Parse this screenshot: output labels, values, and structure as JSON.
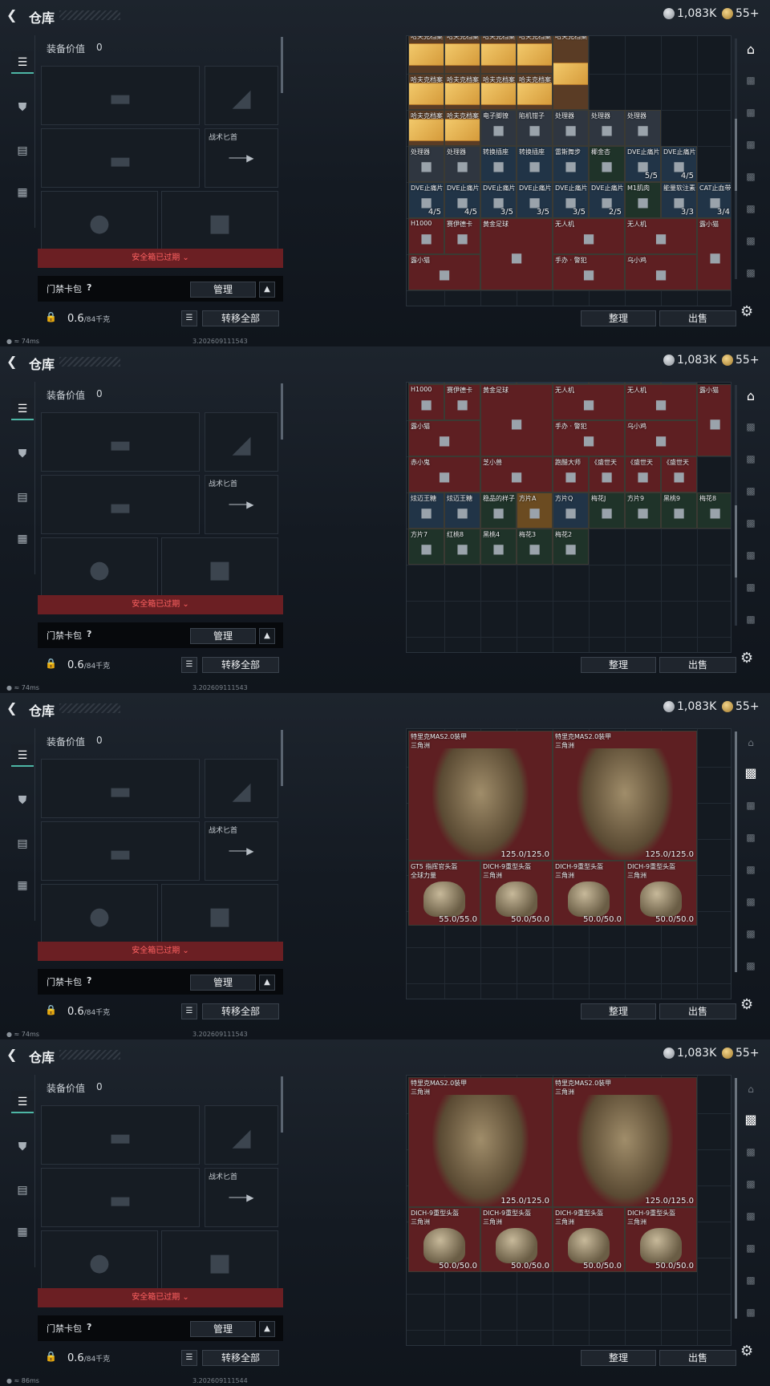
{
  "header": {
    "title": "仓库",
    "silver": "1,083K",
    "gold": "55+"
  },
  "left": {
    "equip_label": "装备价值",
    "equip_value": "0",
    "knife_label": "战术匕首",
    "expired": "安全箱已过期",
    "key_label": "门禁卡包",
    "key_help": "?",
    "manage": "管理",
    "weight": "0.6",
    "weight_cap": "/84千克",
    "move_all": "转移全部"
  },
  "actions": {
    "arrange": "整理",
    "sell": "出售"
  },
  "build": "3.202609111543",
  "build4": "3.202609111544",
  "pings": [
    "74ms",
    "74ms",
    "74ms",
    "86ms"
  ],
  "p1": {
    "r0": [
      "哈夫克档案",
      "哈夫克档案",
      "哈夫克档案",
      "哈夫克档案",
      "哈夫克档案"
    ],
    "r1": [
      "哈夫克档案",
      "哈夫克档案",
      "哈夫克档案",
      "哈夫克档案"
    ],
    "r2": [
      "哈夫克档案",
      "哈夫克档案",
      "电子脚镣",
      "陷机钳子",
      "处理器",
      "处理器",
      "处理器"
    ],
    "r3": [
      "处理器",
      "处理器",
      "转换插座",
      "转换插座",
      "雷斯舞步",
      "椰金杏",
      "DVE止痛片",
      "DVE止痛片"
    ],
    "r3s": [
      "",
      "",
      "",
      "",
      "",
      "",
      "5/5",
      "4/5"
    ],
    "r4": [
      "DVE止痛片",
      "DVE止痛片",
      "DVE止痛片",
      "DVE止痛片",
      "DVE止痛片",
      "DVE止痛片",
      "M1肌肉",
      "能量软注素",
      "CAT止血带"
    ],
    "r4s": [
      "4/5",
      "4/5",
      "3/5",
      "3/5",
      "3/5",
      "2/5",
      "",
      "3/3",
      "3/4"
    ],
    "r5": [
      "H1000",
      "赛伊德卡",
      "黄金足球",
      "无人机",
      "无人机",
      "露小猫"
    ],
    "r6": [
      "露小猫",
      "手办 · 警犯",
      "乌小鸡"
    ]
  },
  "p2": {
    "r0s": [
      "4/5",
      "4/5",
      "3/5",
      "3/5",
      "3/5",
      "2/5",
      "3/3",
      "3/4"
    ],
    "r1": [
      "H1000",
      "赛伊德卡",
      "黄金足球",
      "无人机",
      "无人机",
      "露小猫"
    ],
    "r2": [
      "露小猫",
      "手办 · 警犯",
      "乌小鸡"
    ],
    "r3": [
      "赤小鬼",
      "芝小兽",
      "跑醋大师",
      "《盛世天",
      "《盛世天",
      "《盛世天"
    ],
    "r4": [
      "炫迈王糖",
      "炫迈王糖",
      "稳品的样子",
      "方片A",
      "方片Q",
      "梅花J",
      "方片9",
      "黑桃9",
      "梅花8"
    ],
    "r5": [
      "方片7",
      "红桃8",
      "黑桃4",
      "梅花3",
      "梅花2"
    ]
  },
  "p3": {
    "armor": [
      {
        "name": "特里克MAS2.0装甲",
        "sub": "三角洲",
        "dur": "125.0/125.0"
      },
      {
        "name": "特里克MAS2.0装甲",
        "sub": "三角洲",
        "dur": "125.0/125.0"
      }
    ],
    "helmets": [
      {
        "name": "GT5 指挥官头盔",
        "sub": "全球力量",
        "dur": "55.0/55.0"
      },
      {
        "name": "DICH-9重型头盔",
        "sub": "三角洲",
        "dur": "50.0/50.0"
      },
      {
        "name": "DICH-9重型头盔",
        "sub": "三角洲",
        "dur": "50.0/50.0"
      },
      {
        "name": "DICH-9重型头盔",
        "sub": "三角洲",
        "dur": "50.0/50.0"
      }
    ]
  },
  "p4": {
    "armor": [
      {
        "name": "特里克MAS2.0装甲",
        "sub": "三角洲",
        "dur": "125.0/125.0"
      },
      {
        "name": "特里克MAS2.0装甲",
        "sub": "三角洲",
        "dur": "125.0/125.0"
      }
    ],
    "helmets": [
      {
        "name": "DICH-9重型头盔",
        "sub": "三角洲",
        "dur": "50.0/50.0"
      },
      {
        "name": "DICH-9重型头盔",
        "sub": "三角洲",
        "dur": "50.0/50.0"
      },
      {
        "name": "DICH-9重型头盔",
        "sub": "三角洲",
        "dur": "50.0/50.0"
      },
      {
        "name": "DICH-9重型头盔",
        "sub": "三角洲",
        "dur": "50.0/50.0"
      }
    ]
  },
  "icons": {
    "back": "back-arrow-icon",
    "gear": "settings-gear-icon",
    "lock": "lock-icon"
  }
}
